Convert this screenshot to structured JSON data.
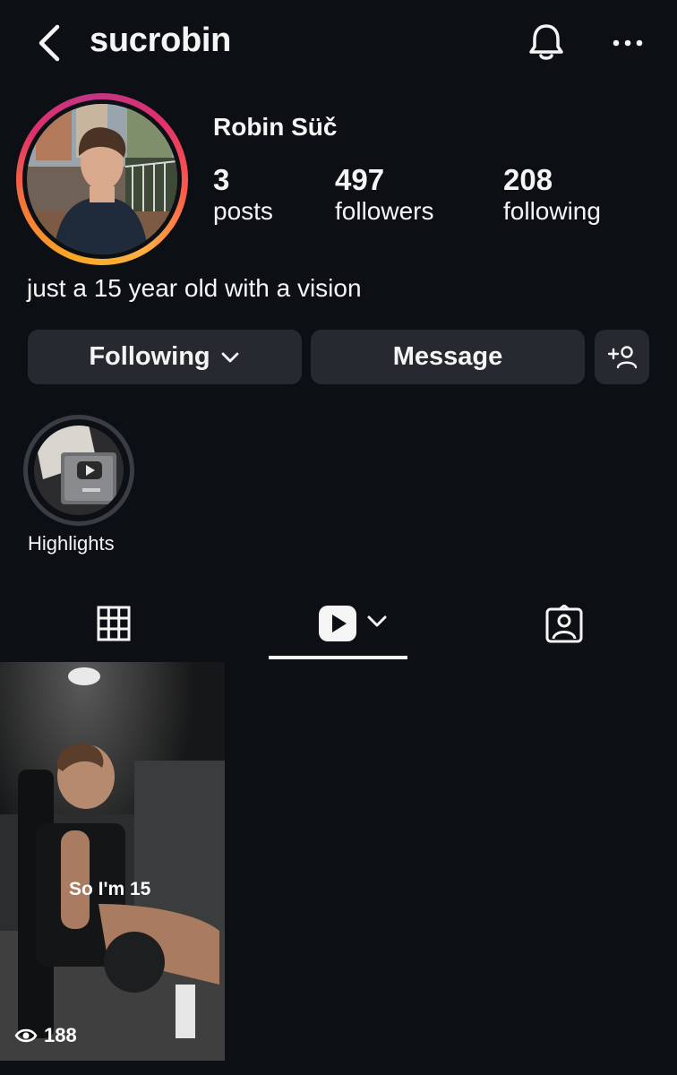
{
  "header": {
    "username": "sucrobin",
    "back_icon": "chevron-left-icon",
    "notifications_icon": "bell-icon",
    "more_icon": "ellipsis-icon"
  },
  "profile": {
    "full_name": "Robin Süč",
    "bio": "just a 15 year old with a vision",
    "avatar_ring_colors": [
      "#f9a825",
      "#f77737",
      "#e1306c",
      "#c13584"
    ]
  },
  "stats": [
    {
      "value": "3",
      "label": "posts"
    },
    {
      "value": "497",
      "label": "followers"
    },
    {
      "value": "208",
      "label": "following"
    }
  ],
  "actions": {
    "following_label": "Following",
    "message_label": "Message",
    "add_user_icon": "add-person-icon"
  },
  "highlights": [
    {
      "label": "Highlights"
    }
  ],
  "tabs": {
    "grid_icon": "grid-icon",
    "reels_icon": "reels-play-icon",
    "tagged_icon": "tagged-person-icon",
    "active": "reels"
  },
  "reels": [
    {
      "caption": "So I'm 15",
      "views": "188",
      "views_icon": "eye-icon"
    }
  ],
  "colors": {
    "background": "#0c1014",
    "button": "#262a30",
    "text": "#f5f5f5"
  }
}
